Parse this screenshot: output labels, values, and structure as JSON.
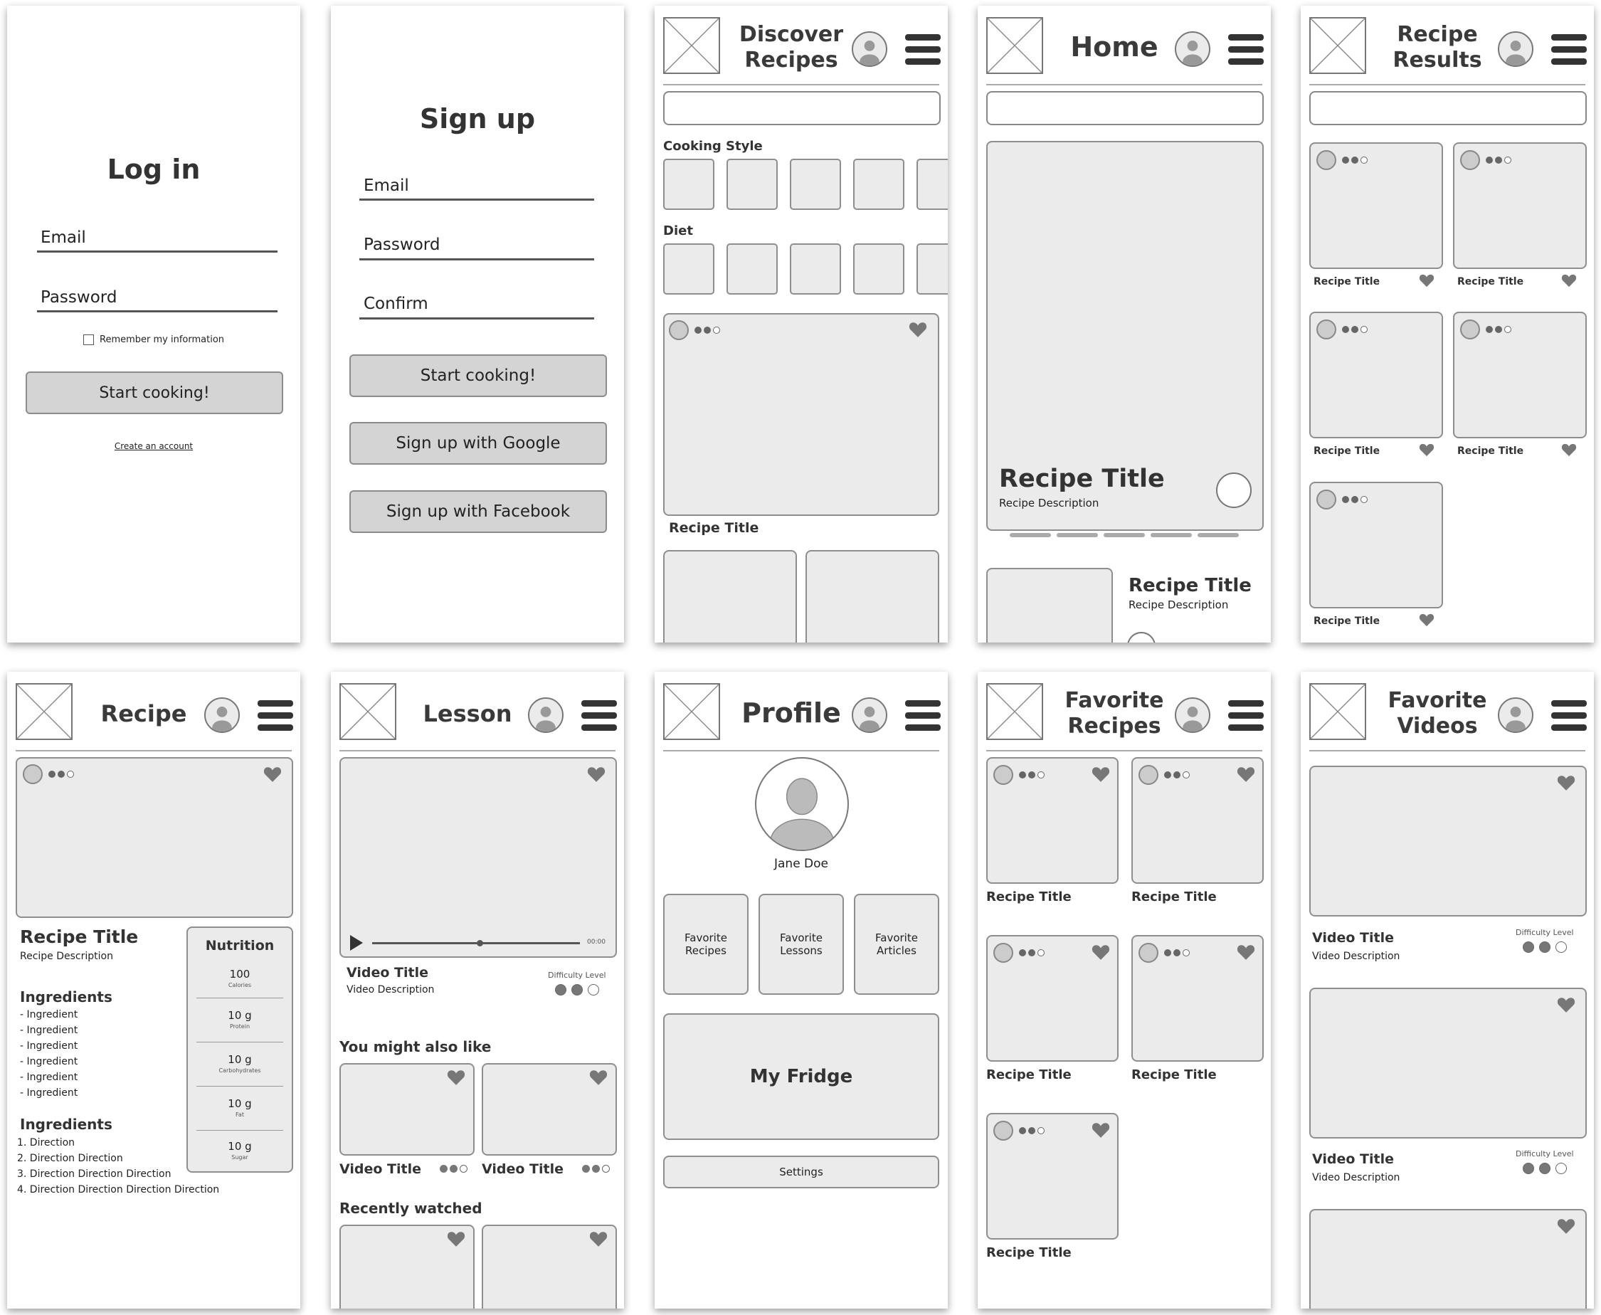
{
  "login": {
    "title": "Log in",
    "email": "Email",
    "password": "Password",
    "remember": "Remember my information",
    "button": "Start cooking!",
    "create": "Create an account"
  },
  "signup": {
    "title": "Sign up",
    "email": "Email",
    "password": "Password",
    "confirm": "Confirm",
    "btn_start": "Start cooking!",
    "btn_google": "Sign up with Google",
    "btn_facebook": "Sign up with Facebook"
  },
  "discover": {
    "title_l1": "Discover",
    "title_l2": "Recipes",
    "cooking_style": "Cooking Style",
    "diet": "Diet",
    "recipe_title": "Recipe Title"
  },
  "home": {
    "title": "Home",
    "hero_title": "Recipe Title",
    "hero_desc": "Recipe Description",
    "card_title": "Recipe Title",
    "card_desc": "Recipe Description"
  },
  "results": {
    "title_l1": "Recipe",
    "title_l2": "Results",
    "recipe_title": "Recipe Title"
  },
  "recipe": {
    "title": "Recipe",
    "recipe_title": "Recipe Title",
    "recipe_desc": "Recipe Description",
    "ingredients_heading": "Ingredients",
    "ingredients": [
      "- Ingredient",
      "- Ingredient",
      "- Ingredient",
      "- Ingredient",
      "- Ingredient",
      "- Ingredient"
    ],
    "directions_heading": "Ingredients",
    "directions": [
      "1. Direction",
      "2. Direction Direction",
      "3. Direction Direction Direction",
      "4. Direction Direction Direction Direction"
    ],
    "nutrition_heading": "Nutrition",
    "nutrition": [
      {
        "value": "100",
        "label": "Calories"
      },
      {
        "value": "10 g",
        "label": "Protein"
      },
      {
        "value": "10 g",
        "label": "Carbohydrates"
      },
      {
        "value": "10 g",
        "label": "Fat"
      },
      {
        "value": "10 g",
        "label": "Sugar"
      }
    ]
  },
  "lesson": {
    "title": "Lesson",
    "time": "00:00",
    "video_title": "Video Title",
    "video_desc": "Video Description",
    "difficulty": "Difficulty Level",
    "also_like": "You might also like",
    "rec_title": "Video Title",
    "recent": "Recently watched"
  },
  "profile": {
    "title": "Profile",
    "name": "Jane Doe",
    "fav_recipes": "Favorite Recipes",
    "fav_lessons": "Favorite Lessons",
    "fav_articles": "Favorite Articles",
    "fridge": "My Fridge",
    "settings": "Settings"
  },
  "fav_recipes": {
    "title_l1": "Favorite",
    "title_l2": "Recipes",
    "recipe_title": "Recipe Title"
  },
  "fav_videos": {
    "title_l1": "Favorite",
    "title_l2": "Videos",
    "video_title": "Video Title",
    "video_desc": "Video Description",
    "difficulty": "Difficulty Level"
  }
}
